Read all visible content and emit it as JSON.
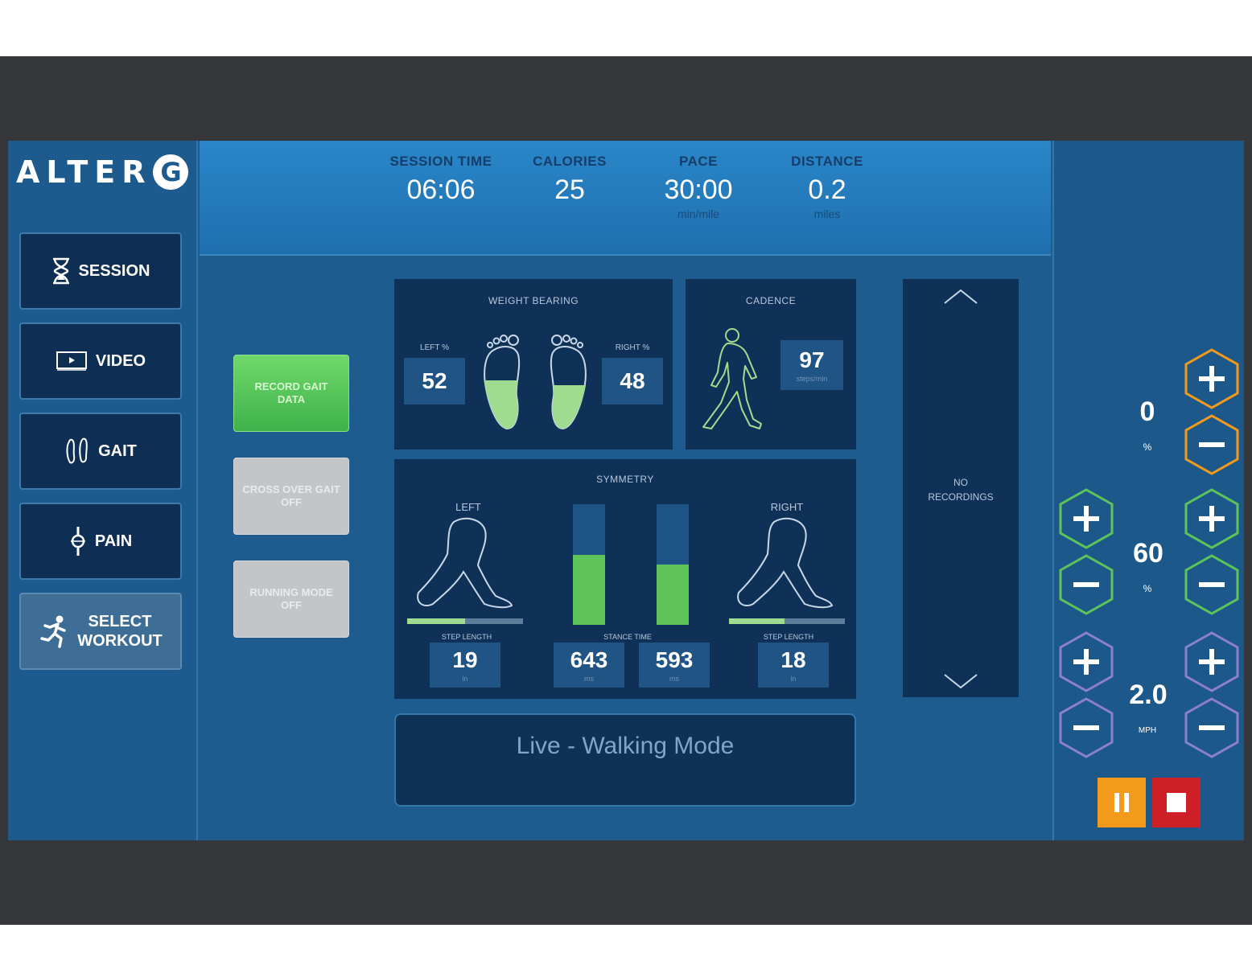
{
  "brand": {
    "logo_text": "ALTER",
    "logo_mark": "G"
  },
  "nav": {
    "session": "SESSION",
    "video": "VIDEO",
    "gait": "GAIT",
    "pain": "PAIN",
    "select_line1": "SELECT",
    "select_line2": "WORKOUT"
  },
  "stats": {
    "session_time": {
      "label": "SESSION TIME",
      "value": "06:06"
    },
    "calories": {
      "label": "CALORIES",
      "value": "25"
    },
    "pace": {
      "label": "PACE",
      "value": "30:00",
      "unit": "min/mile"
    },
    "distance": {
      "label": "DISTANCE",
      "value": "0.2",
      "unit": "miles"
    }
  },
  "gait_buttons": {
    "record": "RECORD GAIT DATA",
    "crossover": "CROSS OVER GAIT OFF",
    "running": "RUNNING MODE OFF"
  },
  "weight_bearing": {
    "title": "WEIGHT BEARING",
    "left_label": "LEFT %",
    "left_value": "52",
    "right_label": "RIGHT %",
    "right_value": "48"
  },
  "cadence": {
    "title": "CADENCE",
    "value": "97",
    "unit": "steps/min"
  },
  "symmetry": {
    "title": "SYMMETRY",
    "left_label": "LEFT",
    "right_label": "RIGHT",
    "left_step_label": "STEP LENGTH",
    "left_step_value": "19",
    "left_step_unit": "in",
    "stance_label": "STANCE TIME",
    "stance_left_value": "643",
    "stance_left_unit": "ms",
    "stance_right_value": "593",
    "stance_right_unit": "ms",
    "right_step_label": "STEP LENGTH",
    "right_step_value": "18",
    "right_step_unit": "in",
    "left_bar_fill": 0.58,
    "right_bar_fill": 0.5,
    "left_step_bar": 0.5,
    "right_step_bar": 0.48
  },
  "recordings": {
    "empty_text_line1": "NO",
    "empty_text_line2": "RECORDINGS"
  },
  "mode": {
    "text": "Live - Walking Mode"
  },
  "controls": {
    "incline": {
      "value": "0",
      "unit": "%"
    },
    "body_weight": {
      "value": "60",
      "unit": "%"
    },
    "speed": {
      "value": "2.0",
      "unit": "MPH"
    }
  },
  "colors": {
    "orange": "#f39a1c",
    "green": "#5ec45a",
    "purple": "#8c7fd0",
    "stop_red": "#cf2027"
  }
}
